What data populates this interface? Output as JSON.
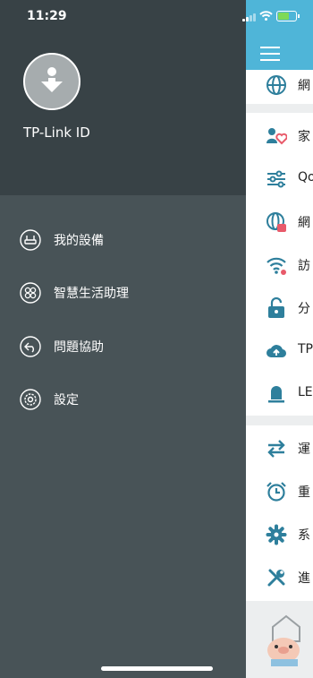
{
  "status_bar": {
    "time": "11:29"
  },
  "drawer": {
    "account_label": "TP-Link ID",
    "items": [
      {
        "label": "我的設備",
        "icon": "router-icon"
      },
      {
        "label": "智慧生活助理",
        "icon": "smart-life-icon"
      },
      {
        "label": "問題協助",
        "icon": "help-icon"
      },
      {
        "label": "設定",
        "icon": "settings-gear-icon"
      }
    ]
  },
  "background_panel": {
    "items": [
      {
        "label": "網",
        "icon": "globe-icon"
      },
      {
        "label": "家",
        "icon": "parental-controls-icon"
      },
      {
        "label": "Qo",
        "icon": "qos-sliders-icon"
      },
      {
        "label": "網",
        "icon": "network-settings-icon"
      },
      {
        "label": "訪",
        "icon": "guest-wifi-icon"
      },
      {
        "label": "分",
        "icon": "lock-icon"
      },
      {
        "label": "TP",
        "icon": "cloud-icon"
      },
      {
        "label": "LE",
        "icon": "led-icon"
      },
      {
        "label": "運",
        "icon": "operation-mode-icon"
      },
      {
        "label": "重",
        "icon": "alarm-clock-icon"
      },
      {
        "label": "系",
        "icon": "system-gear-icon"
      },
      {
        "label": "進",
        "icon": "tools-icon"
      }
    ]
  },
  "colors": {
    "accent": "#4fb5d8",
    "drawer": "#485357",
    "drawer_top": "#384246",
    "icon_teal": "#2e7f9c"
  }
}
